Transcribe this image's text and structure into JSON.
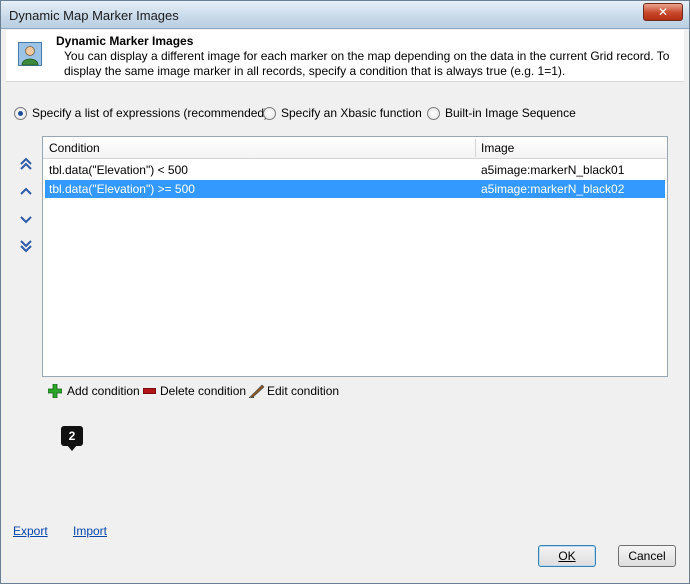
{
  "window": {
    "title": "Dynamic Map Marker Images",
    "close_label": "✕"
  },
  "header": {
    "title": "Dynamic Marker Images",
    "description": "You can display a different image for each marker on the map depending on the data in the current Grid record. To display the same image marker in all records, specify a condition that is always true (e.g. 1=1)."
  },
  "options": {
    "expressions": "Specify a list of expressions (recommended)",
    "xbasic": "Specify an Xbasic function",
    "sequence": "Built-in Image Sequence",
    "selected": "expressions"
  },
  "move_icons": [
    "move-top-icon",
    "move-up-icon",
    "move-down-icon",
    "move-bottom-icon"
  ],
  "grid": {
    "columns": {
      "condition": "Condition",
      "image": "Image"
    },
    "rows": [
      {
        "condition": "tbl.data(\"Elevation\") < 500",
        "image": "a5image:markerN_black01",
        "selected": false
      },
      {
        "condition": "tbl.data(\"Elevation\") >= 500",
        "image": "a5image:markerN_black02",
        "selected": true
      }
    ]
  },
  "toolbar": {
    "add": "Add condition",
    "delete": "Delete condition",
    "edit": "Edit condition"
  },
  "badge": "2",
  "links": {
    "export": "Export",
    "import": "Import"
  },
  "buttons": {
    "ok": "OK",
    "cancel": "Cancel"
  },
  "colors": {
    "selection": "#3399ff",
    "link": "#0645ad",
    "delete_icon": "#b3151b",
    "add_icon": "#2aa52a"
  }
}
